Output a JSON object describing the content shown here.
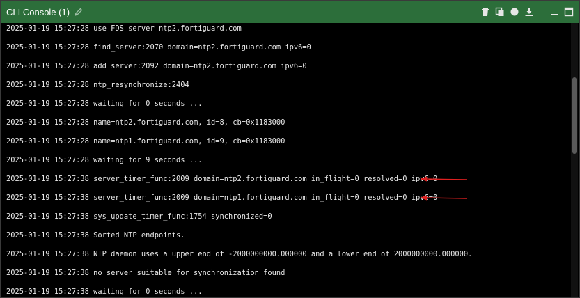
{
  "window": {
    "title": "CLI Console (1)",
    "title_color": "#2c6e3a",
    "icons": [
      "pencil-icon",
      "trash-icon",
      "copy-icon",
      "record-icon",
      "download-icon",
      "minimize-icon",
      "maximize-icon"
    ]
  },
  "console": {
    "lines": [
      "2025-01-19 15:27:28 use FDS server ntp2.fortiguard.com",
      "2025-01-19 15:27:28 find_server:2070 domain=ntp2.fortiguard.com ipv6=0",
      "2025-01-19 15:27:28 add_server:2092 domain=ntp2.fortiguard.com ipv6=0",
      "2025-01-19 15:27:28 ntp_resynchronize:2404",
      "2025-01-19 15:27:28 waiting for 0 seconds ...",
      "2025-01-19 15:27:28 name=ntp2.fortiguard.com, id=8, cb=0x1183000",
      "2025-01-19 15:27:28 name=ntp1.fortiguard.com, id=9, cb=0x1183000",
      "2025-01-19 15:27:28 waiting for 9 seconds ...",
      "2025-01-19 15:27:38 server_timer_func:2009 domain=ntp2.fortiguard.com in_flight=0 resolved=0 ipv6=0",
      "2025-01-19 15:27:38 server_timer_func:2009 domain=ntp1.fortiguard.com in_flight=0 resolved=0 ipv6=0",
      "2025-01-19 15:27:38 sys_update_timer_func:1754 synchronized=0",
      "2025-01-19 15:27:38 Sorted NTP endpoints.",
      "2025-01-19 15:27:38 NTP daemon uses a upper end of -2000000000.000000 and a lower end of 2000000000.000000.",
      "2025-01-19 15:27:38 no server suitable for synchronization found",
      "2025-01-19 15:27:38 waiting for 0 seconds ..."
    ],
    "text_color": "#e8e8e8",
    "background": "#000000",
    "annotation_color": "#e02020"
  }
}
